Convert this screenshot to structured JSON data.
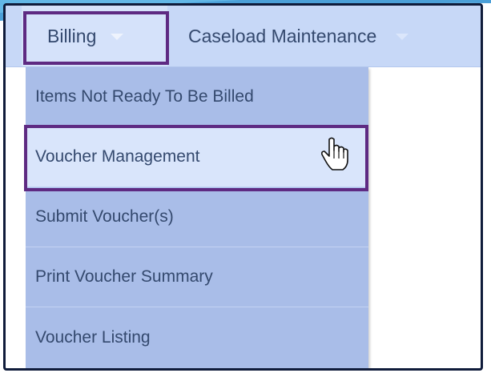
{
  "menubar": {
    "billing_label": "Billing",
    "caseload_label": "Caseload Maintenance"
  },
  "dropdown": {
    "items": [
      {
        "label": "Items Not Ready To Be Billed"
      },
      {
        "label": "Voucher Management",
        "hovered": true
      },
      {
        "label": "Submit Voucher(s)"
      },
      {
        "label": "Print Voucher Summary"
      },
      {
        "label": "Voucher Listing"
      }
    ]
  },
  "colors": {
    "menubar_bg": "#c7d8f7",
    "dropdown_bg": "#a9bde8",
    "hover_bg": "#d9e5fb",
    "text": "#34496e",
    "highlight_border": "#5e2a82",
    "frame": "#0f1b3a"
  },
  "icons": {
    "caret": "chevron-down-icon",
    "cursor": "hand-pointer-icon"
  }
}
